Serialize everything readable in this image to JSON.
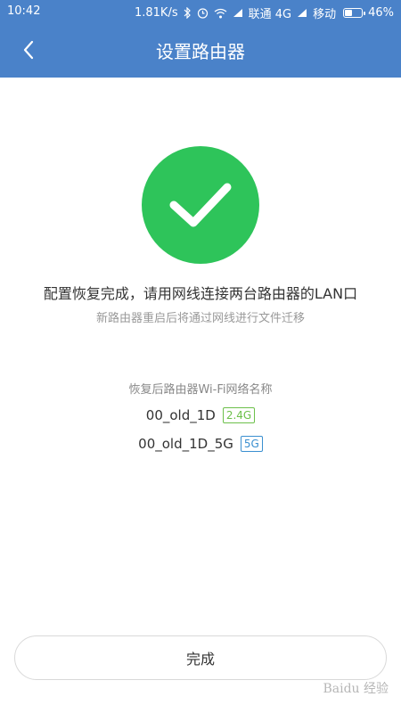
{
  "status_bar": {
    "time": "10:42",
    "speed": "1.81K/s",
    "carrier1": "联通 4G",
    "carrier2": "移动",
    "battery": "46%",
    "battery_level": 0.46
  },
  "header": {
    "title": "设置路由器",
    "background": "#4a82c9"
  },
  "success": {
    "icon": "check-icon",
    "color": "#2ec45a",
    "message": "配置恢复完成，请用网线连接两台路由器的LAN口",
    "sub_message": "新路由器重启后将通过网线进行文件迁移"
  },
  "wifi": {
    "caption": "恢复后路由器Wi-Fi网络名称",
    "networks": [
      {
        "name": "00_old_1D",
        "band": "2.4G",
        "band_color": "#6cc04a"
      },
      {
        "name": "00_old_1D_5G",
        "band": "5G",
        "band_color": "#3a8fd0"
      }
    ]
  },
  "actions": {
    "done_label": "完成"
  },
  "watermark": "Baidu 经验"
}
